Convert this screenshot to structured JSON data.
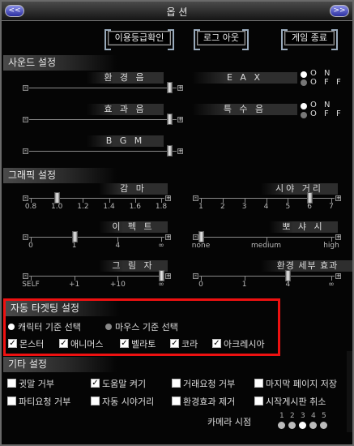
{
  "window": {
    "title": "옵 션",
    "left_button": "<<",
    "right_button": ">>"
  },
  "top_buttons": {
    "grade": "이용등급확인",
    "logout": "로그 아웃",
    "quit": "게임 종료"
  },
  "sound": {
    "header": "사운드 설정",
    "env_label": "환 경 음",
    "effect_label": "효 과 음",
    "bgm_label": "B G M",
    "eax_label": "E A X",
    "special_label": "특 수 음",
    "on": "O N",
    "off": "O F F",
    "env_level": 0.97,
    "effect_level": 0.97,
    "bgm_level": 0.97,
    "eax_selected": "ON",
    "special_selected": "ON"
  },
  "graphics": {
    "header": "그래픽 설정",
    "gamma": {
      "label": "감 마",
      "ticks": [
        "0.8",
        "1.0",
        "1.2",
        "1.4",
        "1.6",
        "1.8"
      ],
      "value": "1.0"
    },
    "view": {
      "label": "시야 거리",
      "ticks": [
        "1",
        "2",
        "3",
        "4",
        "5",
        "6",
        "7"
      ],
      "value": "6"
    },
    "effect": {
      "label": "이 펙 트",
      "ticks": [
        "0",
        "1",
        "4",
        "∞"
      ],
      "value": "1"
    },
    "blur": {
      "label": "뽀 샤 시",
      "ticks": [
        "none",
        "medium",
        "high"
      ],
      "value": "none"
    },
    "shadow": {
      "label": "그 림 자",
      "ticks": [
        "SELF",
        "+1",
        "+10",
        "∞"
      ],
      "value": "∞"
    },
    "detail": {
      "label": "환경 세부 효과",
      "ticks": [
        "0",
        "1",
        "4",
        "∞"
      ],
      "value": "4"
    }
  },
  "targeting": {
    "header": "자동 타겟팅 설정",
    "radio_char": "캐릭터 기준 선택",
    "radio_mouse": "마우스 기준 선택",
    "selected": "캐릭터 기준 선택",
    "checks": [
      {
        "label": "몬스터",
        "checked": true
      },
      {
        "label": "애니머스",
        "checked": true
      },
      {
        "label": "벨라토",
        "checked": true
      },
      {
        "label": "코라",
        "checked": true
      },
      {
        "label": "아크레시아",
        "checked": true
      }
    ]
  },
  "misc": {
    "header": "기타 설정",
    "row1": [
      {
        "label": "귓말 거부",
        "checked": false
      },
      {
        "label": "도움말 켜기",
        "checked": true
      },
      {
        "label": "거래요청 거부",
        "checked": false
      },
      {
        "label": "마지막 페이지 저장",
        "checked": false
      }
    ],
    "row2": [
      {
        "label": "파티요청 거부",
        "checked": false
      },
      {
        "label": "자동 시야거리",
        "checked": false
      },
      {
        "label": "환경효과 제거",
        "checked": false
      },
      {
        "label": "시작게시판 취소",
        "checked": false
      }
    ],
    "camera_label": "카메라 시점",
    "camera_options": [
      "1",
      "2",
      "3",
      "4",
      "5"
    ],
    "camera_selected": "3"
  }
}
